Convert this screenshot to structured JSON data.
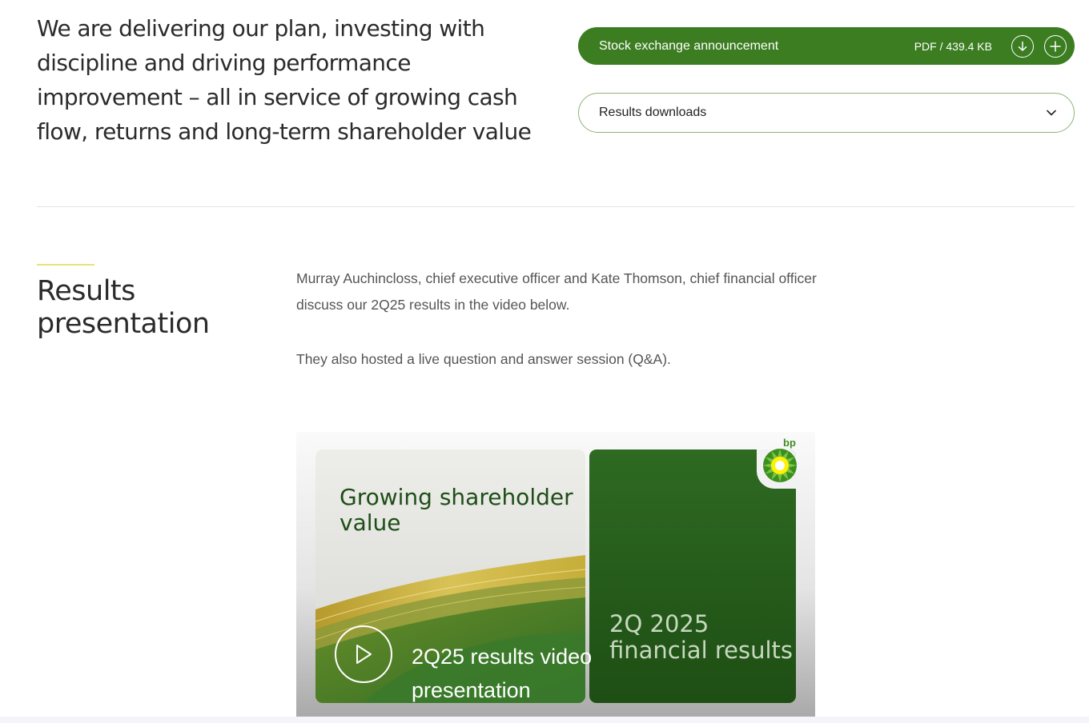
{
  "intro": {
    "text": "We are delivering our plan, investing with discipline and driving performance improvement – all in service of growing cash flow, returns and long-term shareholder value"
  },
  "announcement": {
    "label": "Stock exchange announcement",
    "meta": "PDF / 439.4 KB",
    "download_icon": "download-arrow-icon",
    "add_icon": "plus-icon"
  },
  "downloads": {
    "label": "Results downloads",
    "icon": "chevron-down-icon"
  },
  "section": {
    "title": "Results presentation",
    "paragraph1": "Murray Auchincloss, chief executive officer and Kate Thomson, chief financial officer discuss our 2Q25 results in the video below.",
    "paragraph2": "They also hosted a live question and answer session (Q&A)."
  },
  "video": {
    "left_title": "Growing shareholder value",
    "right_title": "2Q 2025 financial results",
    "brand": "bp",
    "caption": "2Q25 results video presentation",
    "play_icon": "play-icon"
  },
  "colors": {
    "brand_green": "#3c7d22",
    "dark_green": "#1e4e14",
    "accent_yellow": "#e6e27a"
  }
}
